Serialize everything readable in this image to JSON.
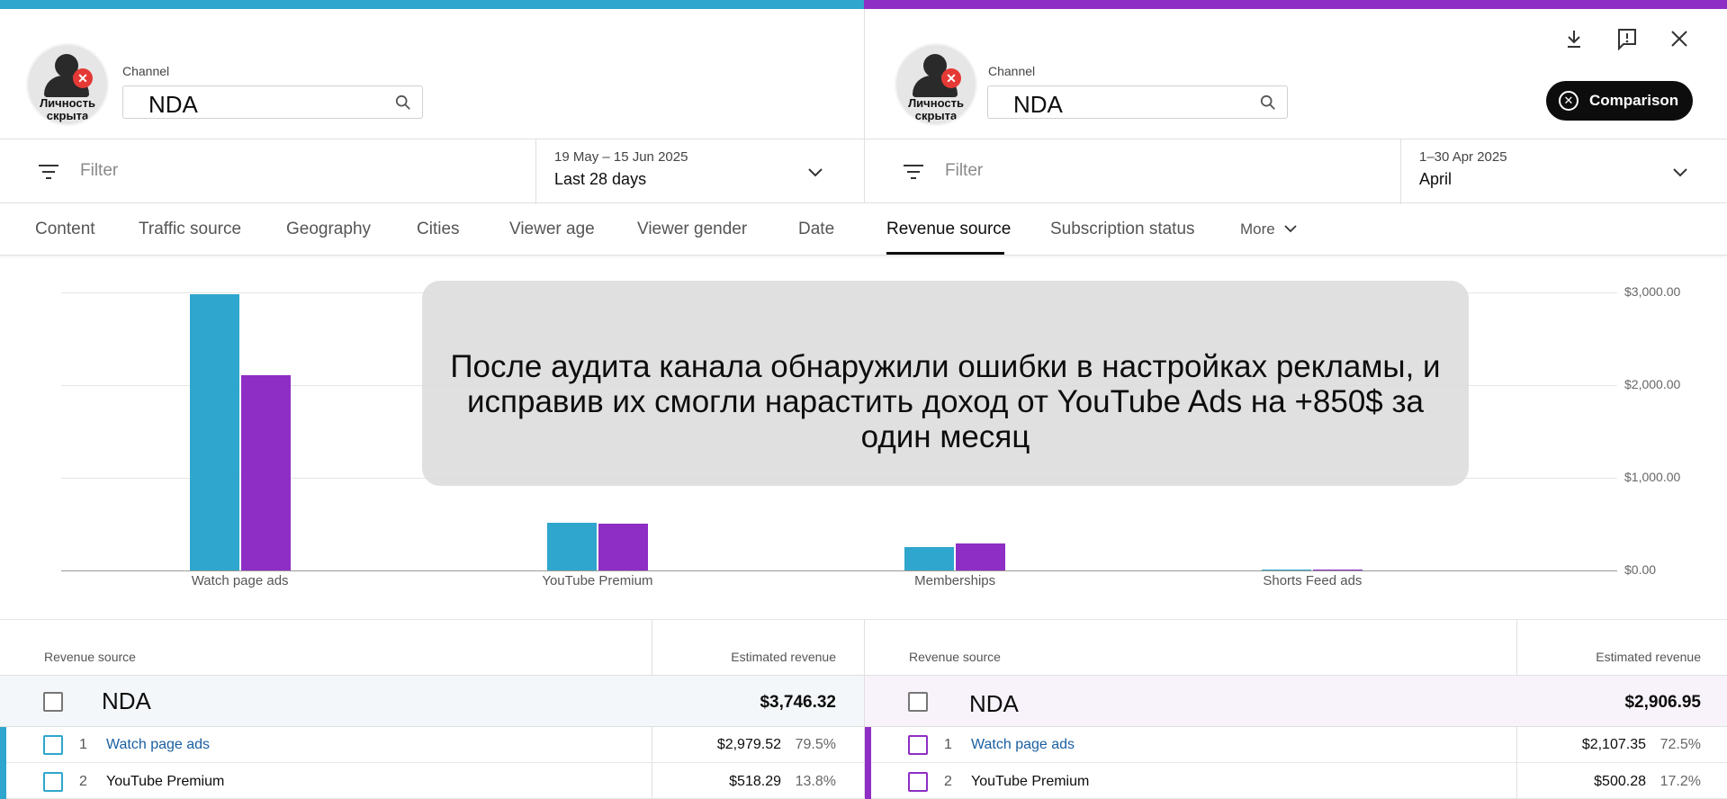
{
  "colors": {
    "current": "#2fa6cd",
    "compare": "#8e2ec4"
  },
  "left": {
    "avatar_caption": "Личность скрыта",
    "channel_label": "Channel",
    "channel_value": "NDA",
    "filter_placeholder": "Filter",
    "date_range": "19 May – 15 Jun 2025",
    "date_name": "Last 28 days"
  },
  "right": {
    "avatar_caption": "Личность скрыта",
    "channel_label": "Channel",
    "channel_value": "NDA",
    "filter_placeholder": "Filter",
    "date_range": "1–30 Apr 2025",
    "date_name": "April",
    "comparison_label": "Comparison"
  },
  "toolbar_icons": [
    "download-icon",
    "feedback-icon",
    "close-icon"
  ],
  "tabs": [
    {
      "label": "Content"
    },
    {
      "label": "Traffic source"
    },
    {
      "label": "Geography"
    },
    {
      "label": "Cities"
    },
    {
      "label": "Viewer age"
    },
    {
      "label": "Viewer gender"
    },
    {
      "label": "Date"
    },
    {
      "label": "Revenue source",
      "active": true
    },
    {
      "label": "Subscription status"
    },
    {
      "label": "More"
    }
  ],
  "chart_data": {
    "type": "bar",
    "categories": [
      "Watch page ads",
      "YouTube Premium",
      "Memberships",
      "Shorts Feed ads"
    ],
    "series": [
      {
        "values": [
          2979.52,
          518.29,
          250,
          10
        ]
      },
      {
        "values": [
          2107.35,
          500.28,
          290,
          12
        ]
      }
    ],
    "ylim": [
      0,
      3000
    ],
    "yticks": [
      "$3,000.00",
      "$2,000.00",
      "$1,000.00",
      "$0.00"
    ],
    "grid": true
  },
  "overlay_text": "После аудита канала обнаружили ошибки в настройках рекламы, и исправив их смогли нарастить доход от YouTube Ads на +850$ за один месяц",
  "table": {
    "left": {
      "col_source": "Revenue source",
      "col_revenue": "Estimated revenue",
      "total_name": "NDA",
      "total_value": "$3,746.32",
      "rows": [
        {
          "rank": "1",
          "name": "Watch page ads",
          "value": "$2,979.52",
          "pct": "79.5%"
        },
        {
          "rank": "2",
          "name": "YouTube Premium",
          "value": "$518.29",
          "pct": "13.8%"
        }
      ]
    },
    "right": {
      "col_source": "Revenue source",
      "col_revenue": "Estimated revenue",
      "total_name": "NDA",
      "total_value": "$2,906.95",
      "rows": [
        {
          "rank": "1",
          "name": "Watch page ads",
          "value": "$2,107.35",
          "pct": "72.5%"
        },
        {
          "rank": "2",
          "name": "YouTube Premium",
          "value": "$500.28",
          "pct": "17.2%"
        }
      ]
    }
  }
}
